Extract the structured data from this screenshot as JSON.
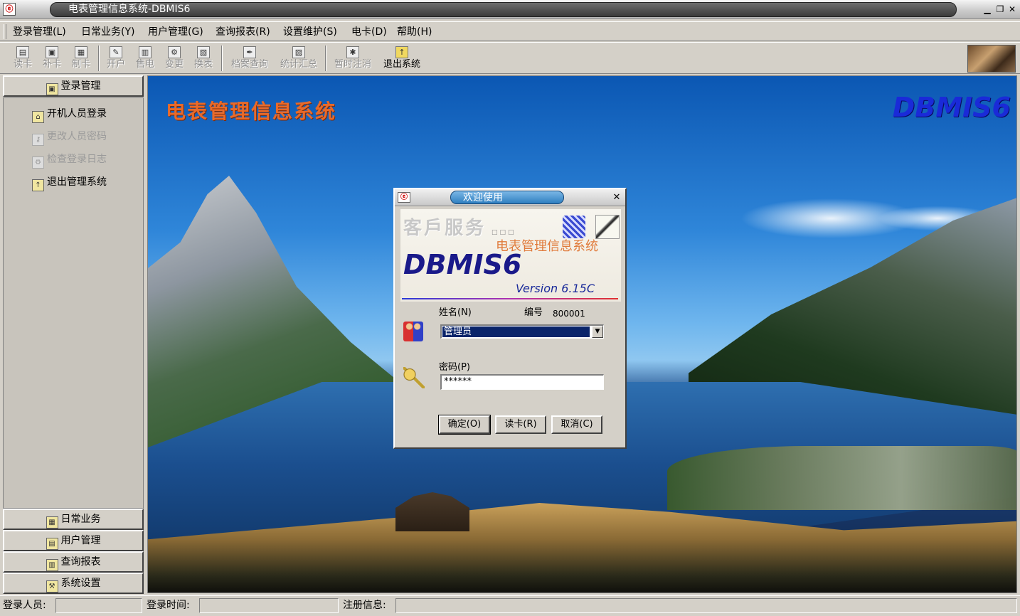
{
  "window": {
    "title": "电表管理信息系统-DBMIS6"
  },
  "menu": [
    "登录管理(L)",
    "日常业务(Y)",
    "用户管理(G)",
    "查询报表(R)",
    "设置维护(S)",
    "电卡(D)",
    "帮助(H)"
  ],
  "toolbar": [
    {
      "label": "读卡",
      "enabled": false
    },
    {
      "label": "补卡",
      "enabled": false
    },
    {
      "label": "制卡",
      "enabled": false
    },
    {
      "label": "开户",
      "enabled": false
    },
    {
      "label": "售电",
      "enabled": false
    },
    {
      "label": "变更",
      "enabled": false
    },
    {
      "label": "换表",
      "enabled": false
    },
    {
      "label": "档案查询",
      "enabled": false
    },
    {
      "label": "统计汇总",
      "enabled": false
    },
    {
      "label": "暂时注消",
      "enabled": false
    },
    {
      "label": "退出系统",
      "enabled": true
    }
  ],
  "sidebar": {
    "active_section": "登录管理",
    "links": [
      {
        "label": "开机人员登录",
        "enabled": true
      },
      {
        "label": "更改人员密码",
        "enabled": false
      },
      {
        "label": "检查登录日志",
        "enabled": false
      },
      {
        "label": "退出管理系统",
        "enabled": true
      }
    ],
    "sections": [
      "日常业务",
      "用户管理",
      "查询报表",
      "系统设置"
    ]
  },
  "main": {
    "title": "电表管理信息系统",
    "logo": "DBMIS6"
  },
  "dialog": {
    "title": "欢迎使用",
    "banner_service": "客戶服务",
    "banner_dots": "□□□",
    "banner_subtitle": "电表管理信息系统",
    "banner_logo": "DBMIS6",
    "banner_version": "Version  6.15C",
    "name_label": "姓名(N)",
    "id_label": "编号",
    "id_value": "800001",
    "name_value": "管理员",
    "password_label": "密码(P)",
    "password_value": "******",
    "buttons": {
      "ok": "确定(O)",
      "read_card": "读卡(R)",
      "cancel": "取消(C)"
    }
  },
  "status": {
    "user_label": "登录人员:",
    "time_label": "登录时间:",
    "reg_label": "注册信息:"
  },
  "colors": {
    "title_orange": "#e86a2a",
    "logo_blue": "#1a2ad8",
    "selection": "#0a246a"
  }
}
